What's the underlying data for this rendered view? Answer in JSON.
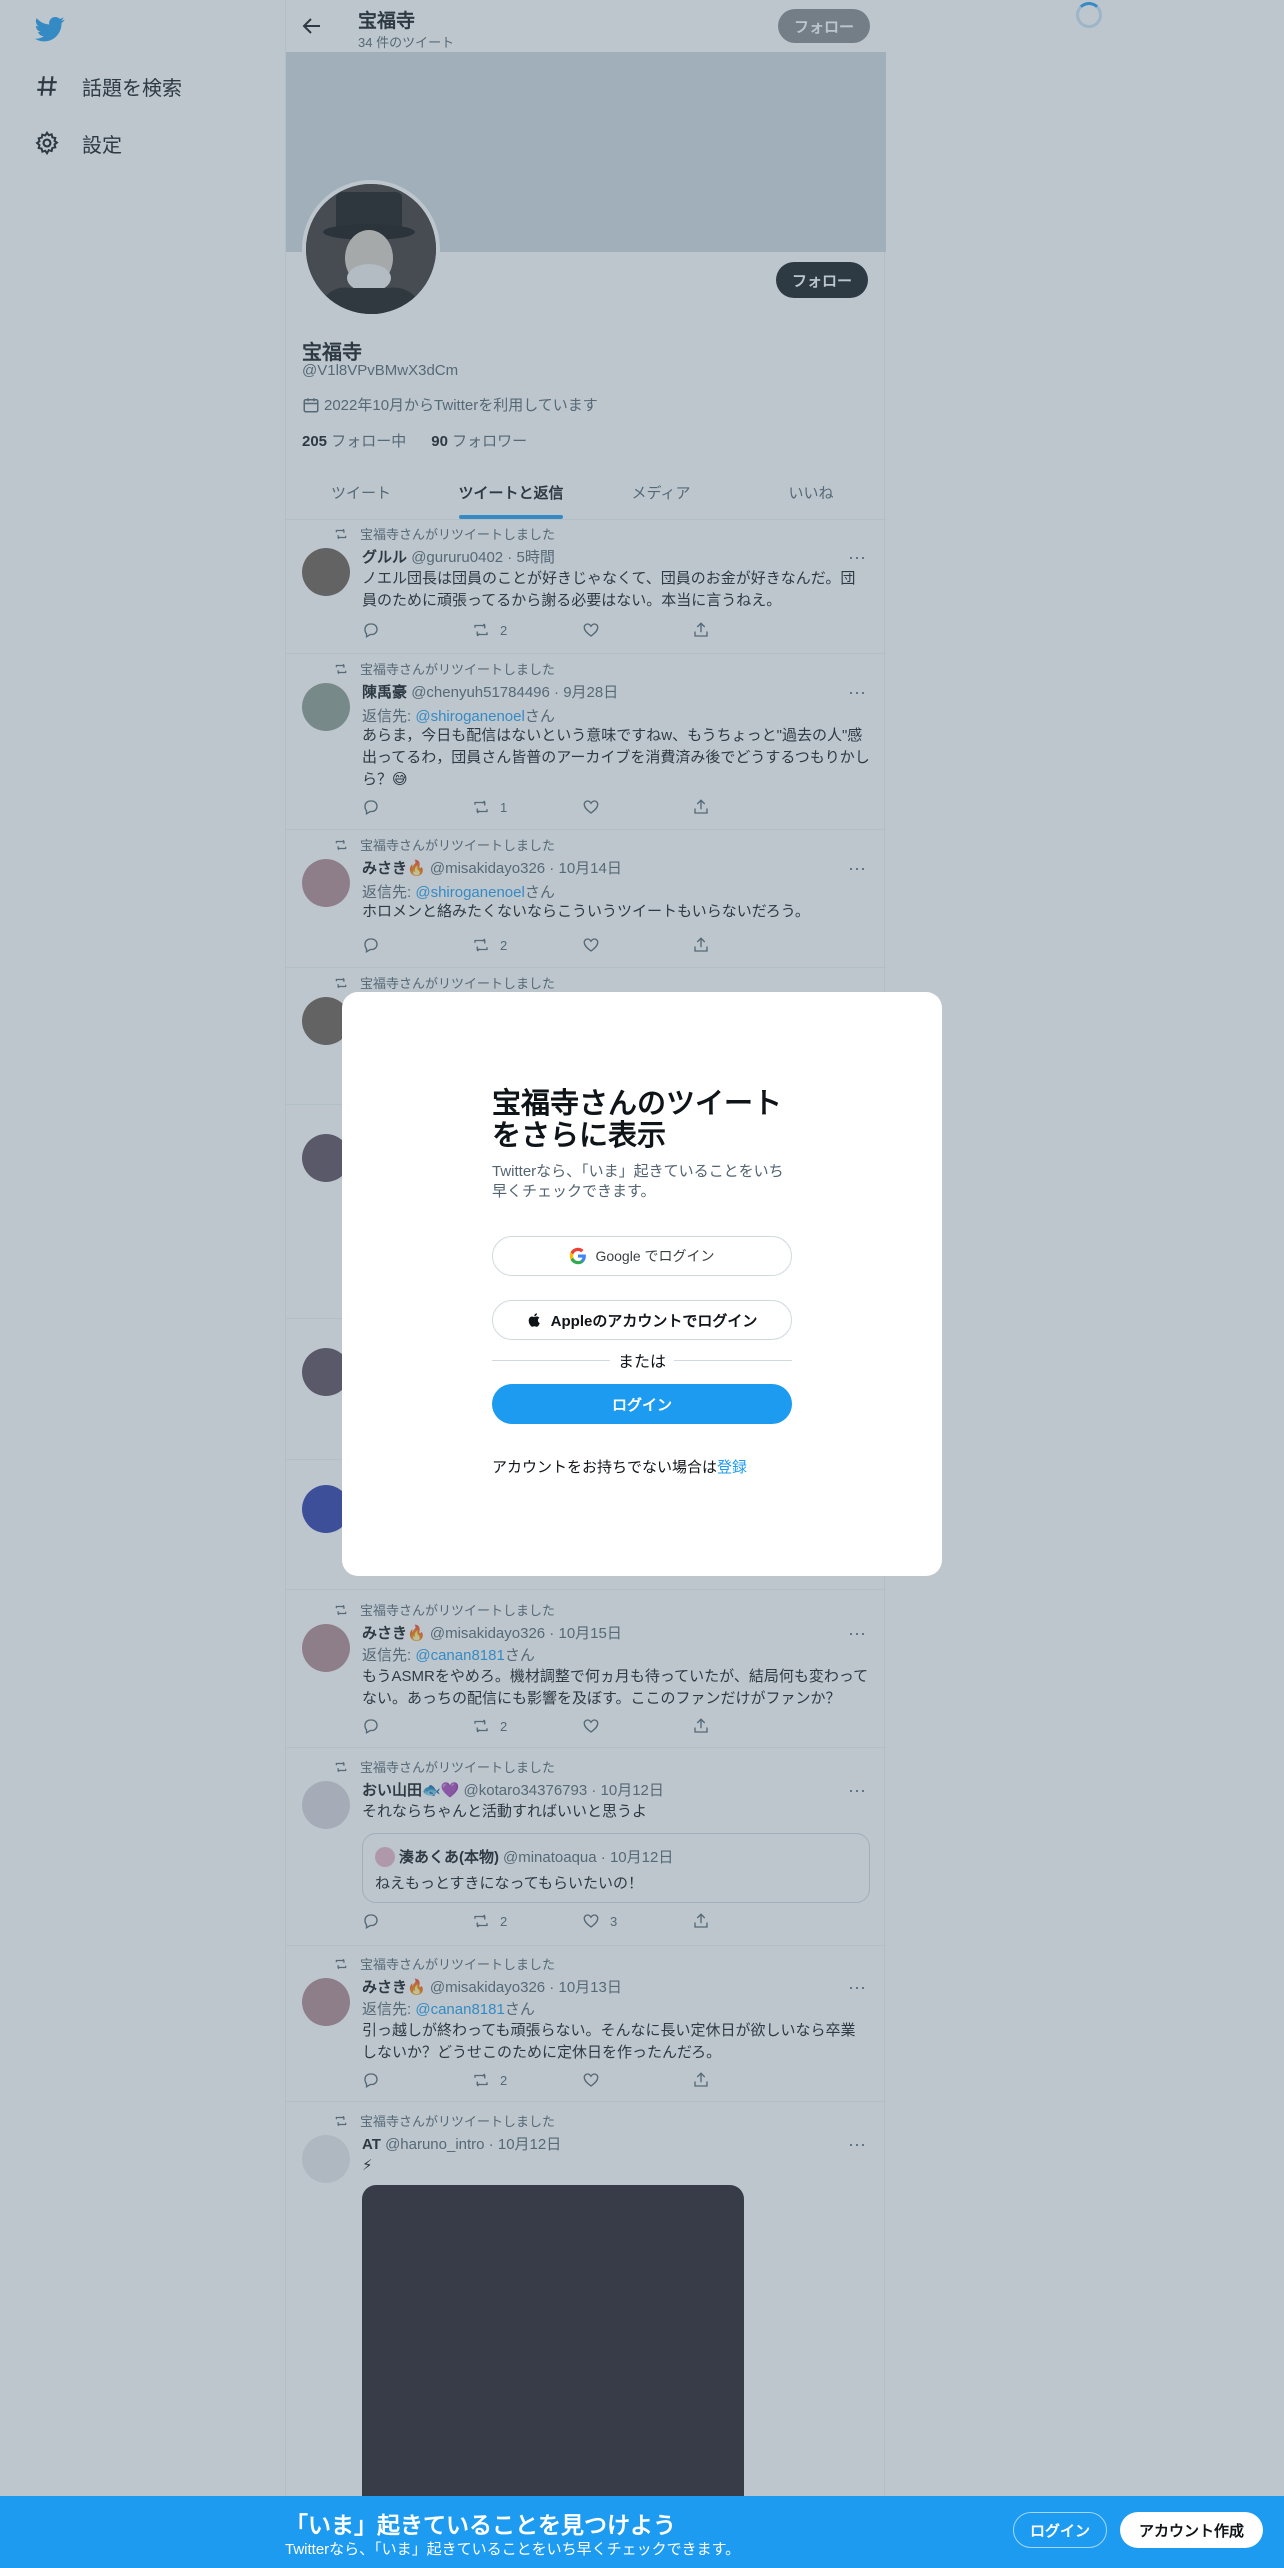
{
  "nav": {
    "explore_label": "話題を検索",
    "settings_label": "設定"
  },
  "header": {
    "title": "宝福寺",
    "tweet_count": "34 件のツイート",
    "follow_label": "フォロー"
  },
  "profile": {
    "name": "宝福寺",
    "handle": "@V1l8VPvBMwX3dCm",
    "joined": "2022年10月からTwitterを利用しています",
    "following_count": "205",
    "following_label": "フォロー中",
    "followers_count": "90",
    "followers_label": "フォロワー",
    "follow_label": "フォロー"
  },
  "tabs": [
    "ツイート",
    "ツイートと返信",
    "メディア",
    "いいね"
  ],
  "retweet_label": "宝福寺さんがリツイートしました",
  "tweets": [
    {
      "name": "グルル",
      "meta": "@gururu0402 · 5時間",
      "text": "ノエル団長は団員のことが好きじゃなくて、団員のお金が好きなんだ。団員のために頑張ってるから謝る必要はない。本当に言うねえ。",
      "retweets": "2"
    },
    {
      "name": "陳禹豪",
      "meta": "@chenyuh51784496 · 9月28日",
      "reply_prefix": "返信先: ",
      "reply_to": "@shiroganenoel",
      "reply_suffix": "さん",
      "text": "あらま，今日も配信はないという意味ですねw、もうちょっと\"過去の人\"感出ってるわ，団員さん皆普のアーカイブを消費済み後でどうするつもりかしら？😅",
      "retweets": "1"
    },
    {
      "name": "みさき🔥",
      "meta": "@misakidayo326 · 10月14日",
      "reply_prefix": "返信先: ",
      "reply_to": "@shiroganenoel",
      "reply_suffix": "さん",
      "text": "ホロメンと絡みたくないならこういうツイートもいらないだろう。",
      "retweets": "2"
    },
    {
      "name": "みさき🔥",
      "meta": "@misakidayo326 · 10月15日",
      "reply_prefix": "返信先: ",
      "reply_to": "@canan8181",
      "reply_suffix": "さん",
      "text": "もうASMRをやめろ。機材調整で何ヵ月も待っていたが、結局何も変わってない。あっちの配信にも影響を及ぼす。ここのファンだけがファンか？",
      "retweets": "2"
    },
    {
      "name": "おい山田🐟💜",
      "meta": "@kotaro34376793 · 10月12日",
      "text": "それならちゃんと活動すればいいと思うよ",
      "quote_name": "湊あくあ(本物)",
      "quote_meta": "@minatoaqua · 10月12日",
      "quote_text": "ねえもっとすきになってもらいたいの！",
      "retweets": "2",
      "likes": "3"
    },
    {
      "name": "みさき🔥",
      "meta": "@misakidayo326 · 10月13日",
      "reply_prefix": "返信先: ",
      "reply_to": "@canan8181",
      "reply_suffix": "さん",
      "text": "引っ越しが終わっても頑張らない。そんなに長い定休日が欲しいなら卒業しないか？どうせこのために定休日を作ったんだろ。",
      "retweets": "2"
    },
    {
      "name": "AT",
      "meta": "@haruno_intro · 10月12日",
      "text": "⚡"
    }
  ],
  "modal": {
    "title": "宝福寺さんのツイートをさらに表示",
    "subtitle": "Twitterなら、「いま」起きていることをいち早くチェックできます。",
    "google_label": "Google でログイン",
    "apple_label": "Appleのアカウントでログイン",
    "or_label": "または",
    "login_label": "ログイン",
    "signup_prefix": "アカウントをお持ちでない場合は",
    "signup_link": "登録"
  },
  "bottom_bar": {
    "title": "「いま」起きていることを見つけよう",
    "subtitle": "Twitterなら、「いま」起きていることをいち早くチェックできます。",
    "login_label": "ログイン",
    "signup_label": "アカウント作成"
  },
  "colors": {
    "accent": "#1d9bf0",
    "text": "#0f1419",
    "secondary": "#536471"
  }
}
